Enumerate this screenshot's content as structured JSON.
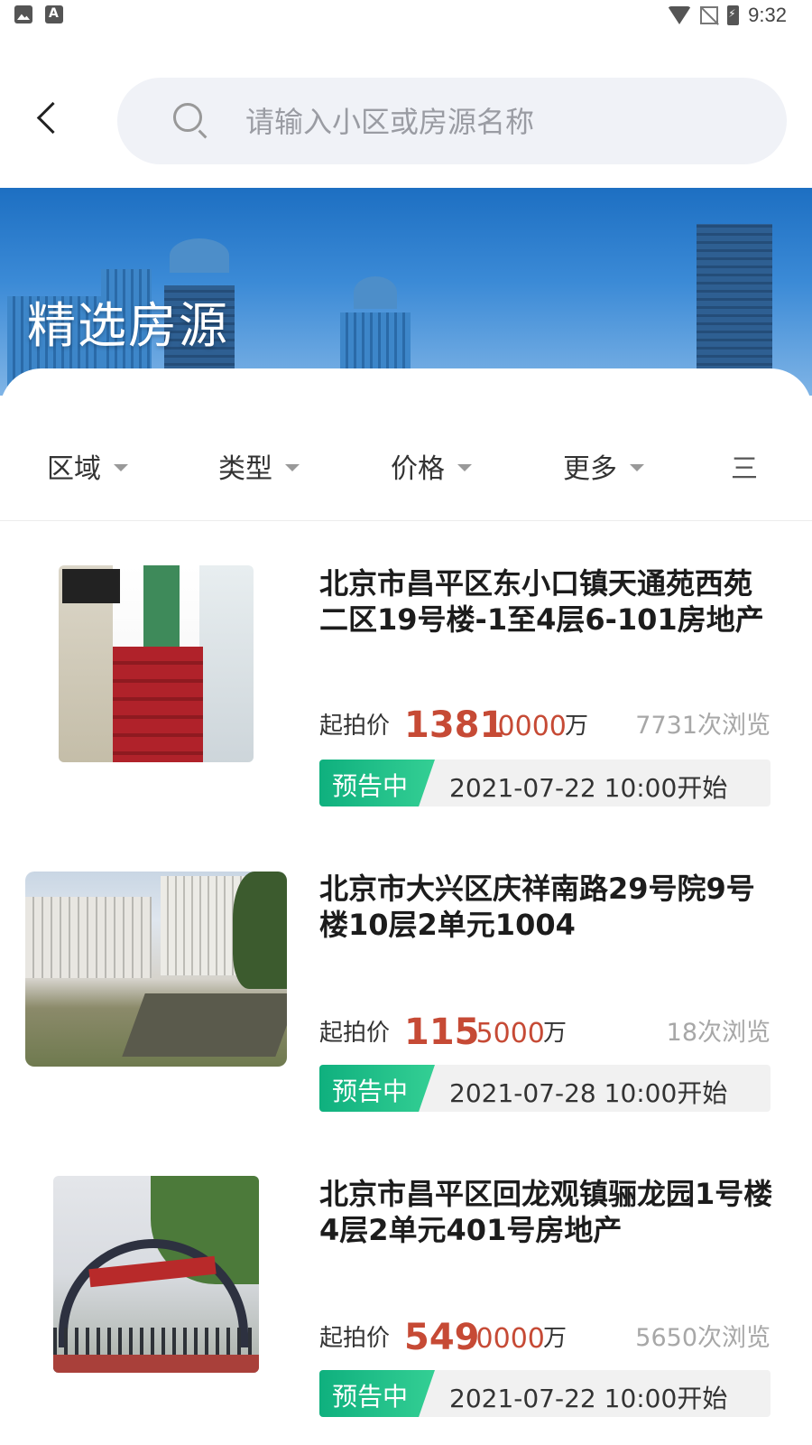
{
  "status_bar": {
    "time": "9:32",
    "left_icons": [
      "image-icon",
      "text-app-icon"
    ],
    "right_icons": [
      "wifi-icon",
      "no-signal-icon",
      "battery-charging-icon"
    ]
  },
  "header": {
    "back_icon": "chevron-left-icon",
    "search_icon": "search-icon",
    "search_placeholder": "请输入小区或房源名称",
    "search_value": ""
  },
  "banner": {
    "title": "精选房源"
  },
  "filters": {
    "items": [
      {
        "label": "区域"
      },
      {
        "label": "类型"
      },
      {
        "label": "价格"
      },
      {
        "label": "更多"
      }
    ],
    "sort_label": "三l"
  },
  "listings": [
    {
      "title": "北京市昌平区东小口镇天通苑西苑二区19号楼-1至4层6-101房地产",
      "price_label": "起拍价",
      "price_int": "1381",
      "price_dec": ".0000",
      "price_unit": "万",
      "views": "7731次浏览",
      "status": "预告中",
      "start": "2021-07-22 10:00开始"
    },
    {
      "title": "北京市大兴区庆祥南路29号院9号楼10层2单元1004",
      "price_label": "起拍价",
      "price_int": "115",
      "price_dec": ".5000",
      "price_unit": "万",
      "views": "18次浏览",
      "status": "预告中",
      "start": "2021-07-28 10:00开始"
    },
    {
      "title": "北京市昌平区回龙观镇骊龙园1号楼4层2单元401号房地产",
      "price_label": "起拍价",
      "price_int": "549",
      "price_dec": ".0000",
      "price_unit": "万",
      "views": "5650次浏览",
      "status": "预告中",
      "start": "2021-07-22 10:00开始"
    }
  ],
  "colors": {
    "price": "#c64a35",
    "status_tag": "#18b886",
    "search_bg": "#f0f2f7"
  }
}
